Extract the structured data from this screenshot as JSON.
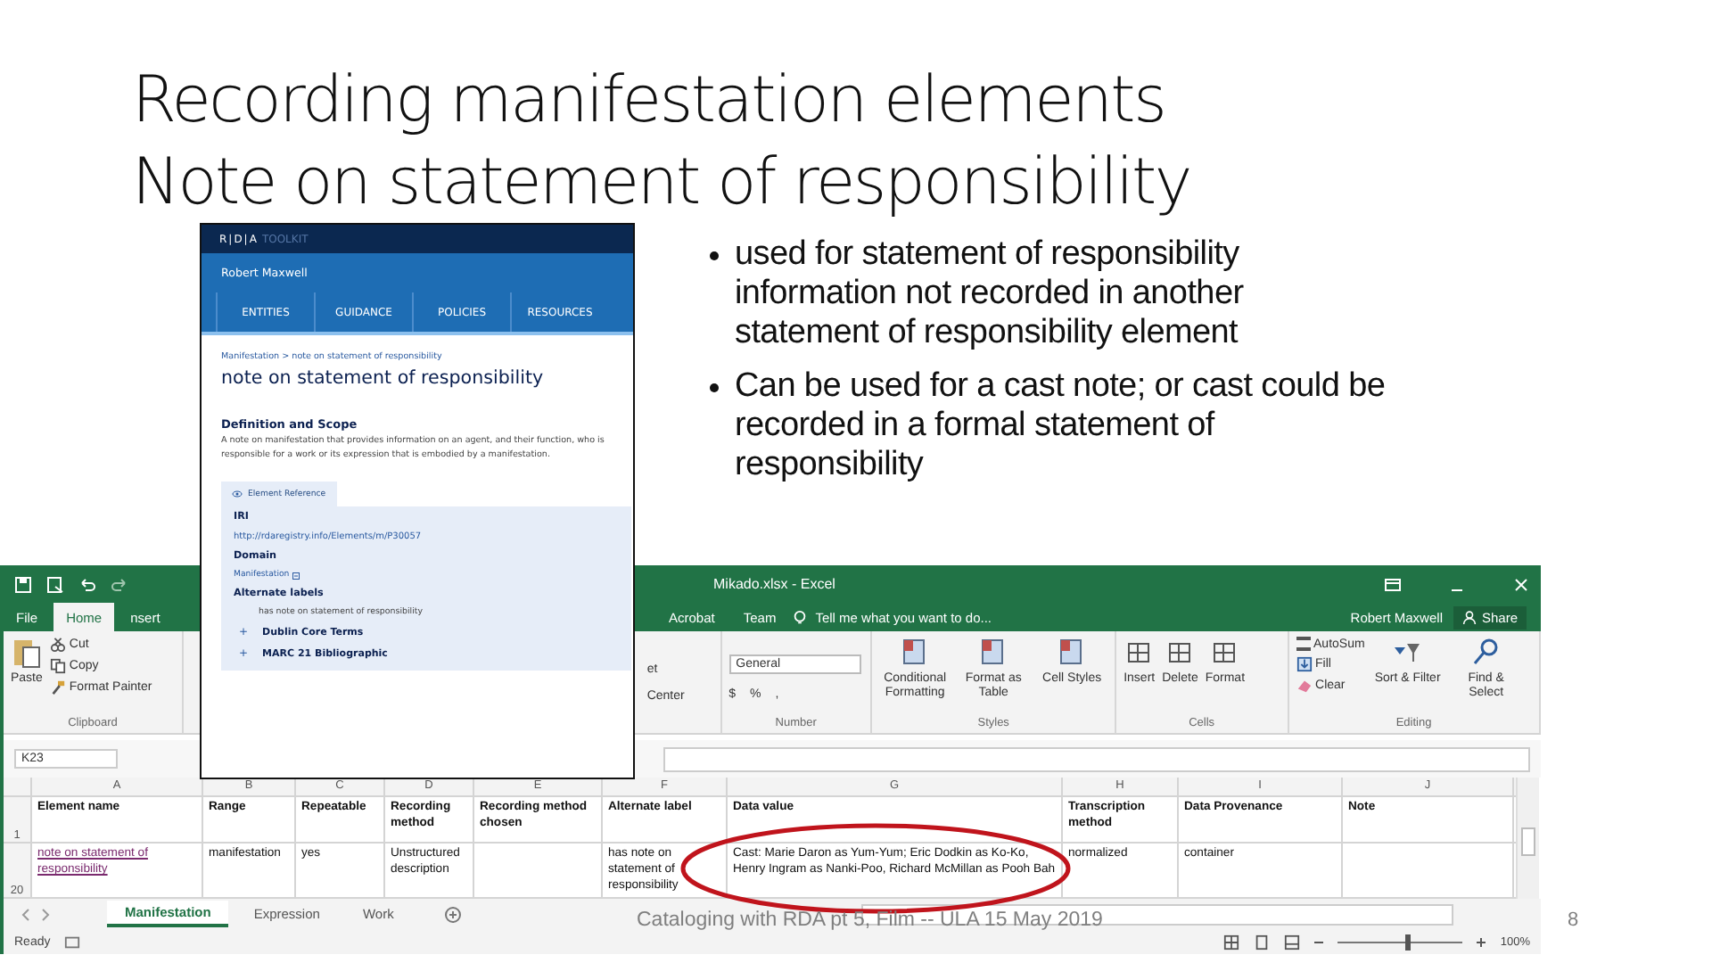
{
  "slide": {
    "title_lines": [
      "Recording manifestation elements",
      "Note on statement of responsibility"
    ],
    "bullets": [
      "used for statement of responsibility information not recorded in another statement of responsibility element",
      "Can be used for a cast note; or cast could be recorded in a formal statement of responsibility"
    ],
    "footer": "Cataloging with RDA pt 5, Film -- ULA 15 May 2019",
    "page_number": "8"
  },
  "excel": {
    "title": "Mikado.xlsx - Excel",
    "tabs": [
      {
        "label": "File",
        "selected": false
      },
      {
        "label": "Home",
        "selected": true
      },
      {
        "label": "nsert",
        "selected": false
      }
    ],
    "tabs_right": [
      {
        "label": "Acrobat",
        "selected": false
      },
      {
        "label": "Team",
        "selected": false
      }
    ],
    "tell_me": "Tell me what you want to do...",
    "user": "Robert Maxwell",
    "share": "Share",
    "clipboard": {
      "paste": "Paste",
      "cut": "Cut",
      "copy": "Copy",
      "painter": "Format Painter",
      "label": "Clipboard"
    },
    "alignment": {
      "wrap": "et",
      "merge": "Center"
    },
    "number": {
      "format": "General",
      "currency": "$",
      "percent": "%",
      "comma": ",",
      "label": "Number"
    },
    "styles": {
      "items": [
        "Conditional Formatting",
        "Format as Table",
        "Cell Styles"
      ],
      "label": "Styles"
    },
    "cells": {
      "items": [
        "Insert",
        "Delete",
        "Format"
      ],
      "label": "Cells"
    },
    "editing": {
      "autosum": "AutoSum",
      "fill": "Fill",
      "clear": "Clear",
      "sort": "Sort & Filter",
      "find": "Find & Select",
      "label": "Editing"
    },
    "name_box": "K23",
    "columns": [
      "A",
      "B",
      "C",
      "D",
      "E",
      "F",
      "G",
      "H",
      "I",
      "J"
    ],
    "rows": [
      {
        "number": "1",
        "header": true,
        "cells": [
          "Element name",
          "Range",
          "Repeatable",
          "Recording method",
          "Recording method chosen",
          "Alternate label",
          "Data value",
          "Transcription method",
          "Data Provenance",
          "Note"
        ]
      },
      {
        "number": "20",
        "header": false,
        "cells": [
          "note on statement of responsibility",
          "manifestation",
          "yes",
          "Unstructured description",
          null,
          "has note on statement of responsibility",
          "Cast: Marie Daron as Yum-Yum; Eric Dodkin as Ko-Ko, Henry Ingram as Nanki-Poo, Richard McMillan as Pooh Bah",
          "normalized",
          "container",
          null
        ]
      }
    ],
    "sheets": [
      {
        "label": "Manifestation",
        "selected": true
      },
      {
        "label": "Expression",
        "selected": false
      },
      {
        "label": "Work",
        "selected": false
      }
    ],
    "status": "Ready",
    "zoom": {
      "level": 0.55,
      "reading": "100%"
    }
  },
  "rda": {
    "logo": "R|D|A",
    "logo_sub": "TOOLKIT",
    "user": "Robert Maxwell",
    "nav": [
      "ENTITIES",
      "GUIDANCE",
      "POLICIES",
      "RESOURCES"
    ],
    "breadcrumb": "Manifestation > note on statement of responsibility",
    "heading": "note on statement of responsibility",
    "section": "Definition and Scope",
    "definition": "A note on manifestation that provides information on an agent, and their function, who is responsible for a work or its expression that is embodied by a manifestation.",
    "panel_tab": "Element Reference",
    "iri_label": "IRI",
    "iri": "http://rdaregistry.info/Elements/m/P30057",
    "domain_label": "Domain",
    "domain": "Manifestation",
    "alt_label": "Alternate labels",
    "alt": "has note on statement of responsibility",
    "expanders": [
      {
        "sign": "+",
        "label": "Dublin Core Terms"
      },
      {
        "sign": "+",
        "label": "MARC 21 Bibliographic"
      }
    ]
  }
}
